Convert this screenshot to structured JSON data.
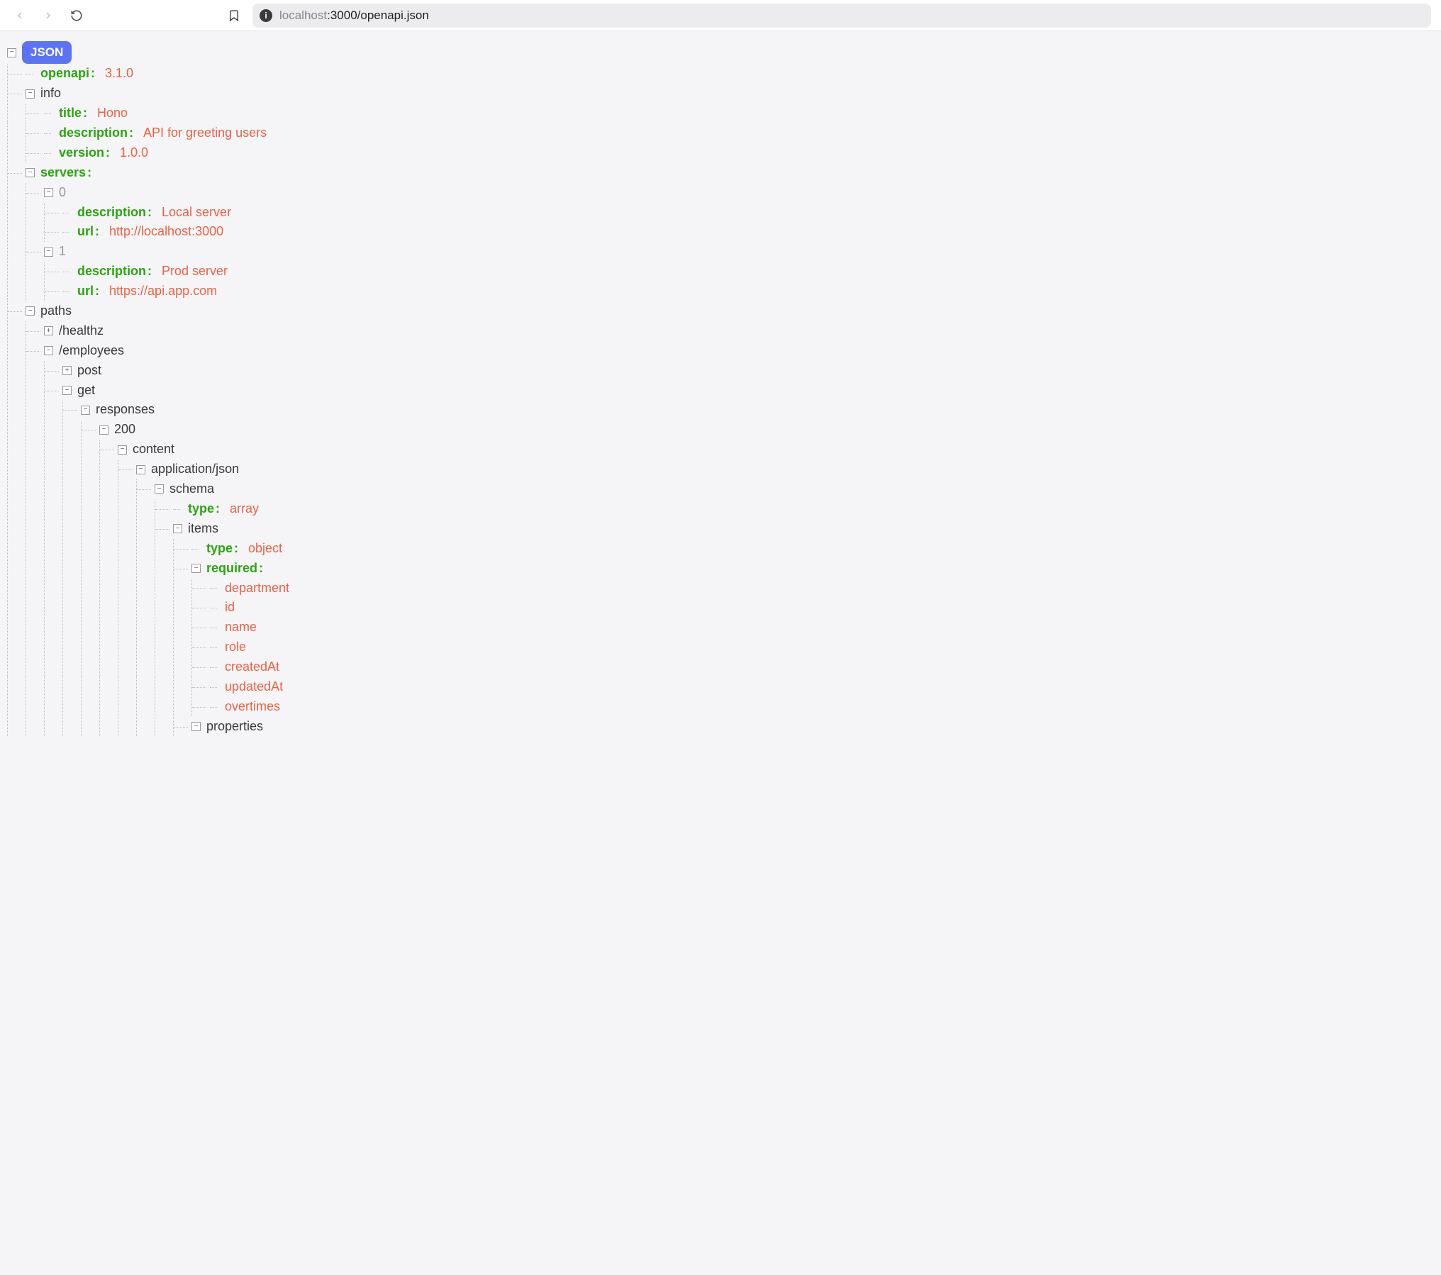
{
  "toolbar": {
    "url_host": "localhost",
    "url_port_path": ":3000/openapi.json"
  },
  "root_badge": "JSON",
  "tree": {
    "openapi": {
      "key": "openapi",
      "value": "3.1.0"
    },
    "info": {
      "key": "info",
      "title": {
        "key": "title",
        "value": "Hono"
      },
      "description": {
        "key": "description",
        "value": "API for greeting users"
      },
      "version": {
        "key": "version",
        "value": "1.0.0"
      }
    },
    "servers": {
      "key": "servers",
      "items": [
        {
          "idx": "0",
          "description": {
            "key": "description",
            "value": "Local server"
          },
          "url": {
            "key": "url",
            "value": "http://localhost:3000"
          }
        },
        {
          "idx": "1",
          "description": {
            "key": "description",
            "value": "Prod server"
          },
          "url": {
            "key": "url",
            "value": "https://api.app.com"
          }
        }
      ]
    },
    "paths": {
      "key": "paths",
      "healthz": {
        "key": "/healthz"
      },
      "employees": {
        "key": "/employees",
        "post": {
          "key": "post"
        },
        "get": {
          "key": "get",
          "responses": {
            "key": "responses",
            "200": {
              "key": "200",
              "content": {
                "key": "content",
                "json": {
                  "key": "application/json",
                  "schema": {
                    "key": "schema",
                    "type": {
                      "key": "type",
                      "value": "array"
                    },
                    "items": {
                      "key": "items",
                      "type": {
                        "key": "type",
                        "value": "object"
                      },
                      "required": {
                        "key": "required",
                        "values": [
                          "department",
                          "id",
                          "name",
                          "role",
                          "createdAt",
                          "updatedAt",
                          "overtimes"
                        ]
                      },
                      "properties": {
                        "key": "properties"
                      }
                    }
                  }
                }
              }
            }
          }
        }
      }
    }
  },
  "toggle_minus": "−",
  "toggle_plus": "+"
}
